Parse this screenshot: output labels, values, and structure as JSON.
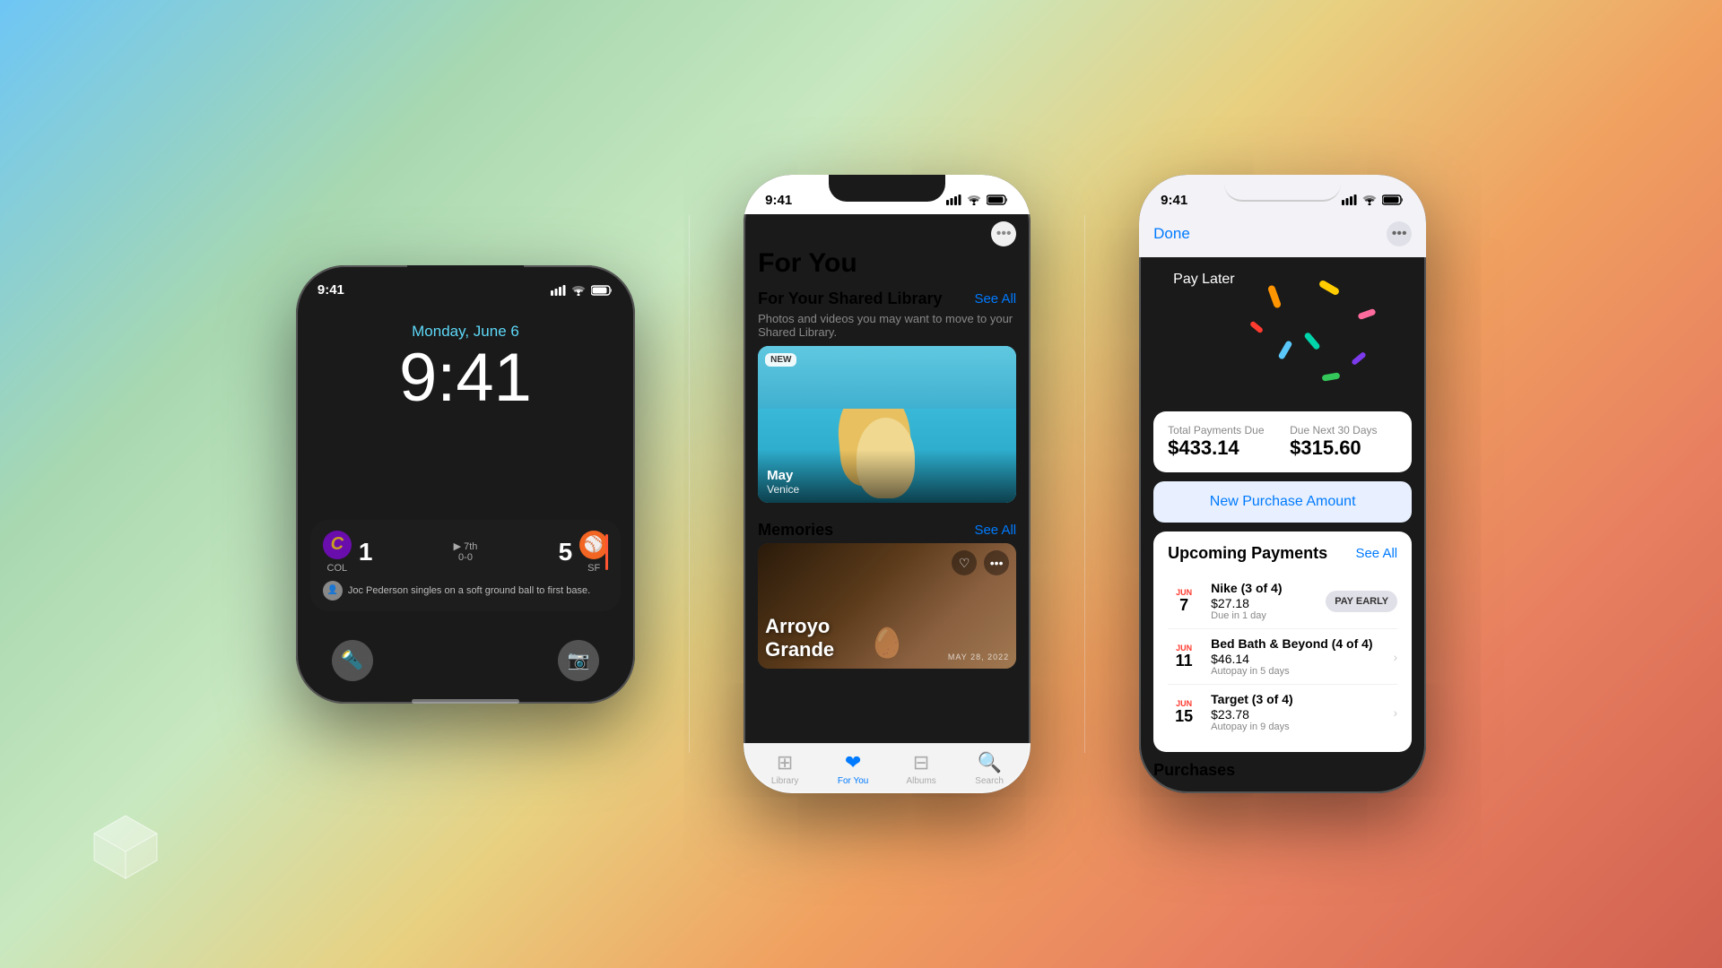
{
  "background": {
    "gradient": "linear-gradient(135deg, #6ec6f5 0%, #a8d8b0 20%, #c8e8c0 35%, #e8d080 50%, #f0a060 65%, #e88060 80%, #d06050 100%)"
  },
  "phone1": {
    "status_time": "9:41",
    "lock_date": "Monday, June 6",
    "lock_time": "9:41",
    "live_activity": {
      "team1": "COL",
      "team1_score": "1",
      "team2": "SF",
      "team2_score": "5",
      "inning": "7th",
      "outs": "0-0",
      "update_text": "Joc Pederson singles on a soft ground ball to first base."
    },
    "bottom_icons": [
      "flashlight",
      "camera"
    ]
  },
  "phone2": {
    "status_time": "9:41",
    "title": "For You",
    "shared_library": {
      "title": "For Your Shared Library",
      "see_all": "See All",
      "description": "Photos and videos you may want to move to your Shared Library.",
      "photo": {
        "badge": "NEW",
        "caption_title": "May",
        "caption_sub": "Venice"
      }
    },
    "memories": {
      "title": "Memories",
      "see_all": "See All",
      "card": {
        "title": "Arroyo Grande",
        "date": "MAY 28, 2022"
      }
    },
    "tabs": [
      "Library",
      "For You",
      "Albums",
      "Search"
    ],
    "active_tab": "For You"
  },
  "phone3": {
    "status_time": "9:41",
    "header": {
      "done": "Done"
    },
    "card": {
      "logo": "Pay Later"
    },
    "payments": {
      "total_label": "Total Payments Due",
      "total_amount": "$433.14",
      "due_next_label": "Due Next 30 Days",
      "due_next_amount": "$315.60"
    },
    "new_purchase": "New Purchase Amount",
    "upcoming": {
      "title": "Upcoming Payments",
      "see_all": "See All",
      "items": [
        {
          "month": "JUN",
          "day": "7",
          "merchant": "Nike (3 of 4)",
          "amount": "$27.18",
          "due": "Due in 1 day",
          "action": "PAY EARLY"
        },
        {
          "month": "JUN",
          "day": "11",
          "merchant": "Bed Bath & Beyond (4 of 4)",
          "amount": "$46.14",
          "due": "Autopay in 5 days",
          "action": "chevron"
        },
        {
          "month": "JUN",
          "day": "15",
          "merchant": "Target (3 of 4)",
          "amount": "$23.78",
          "due": "Autopay in 9 days",
          "action": "chevron"
        }
      ]
    },
    "purchases_label": "Purchases"
  }
}
